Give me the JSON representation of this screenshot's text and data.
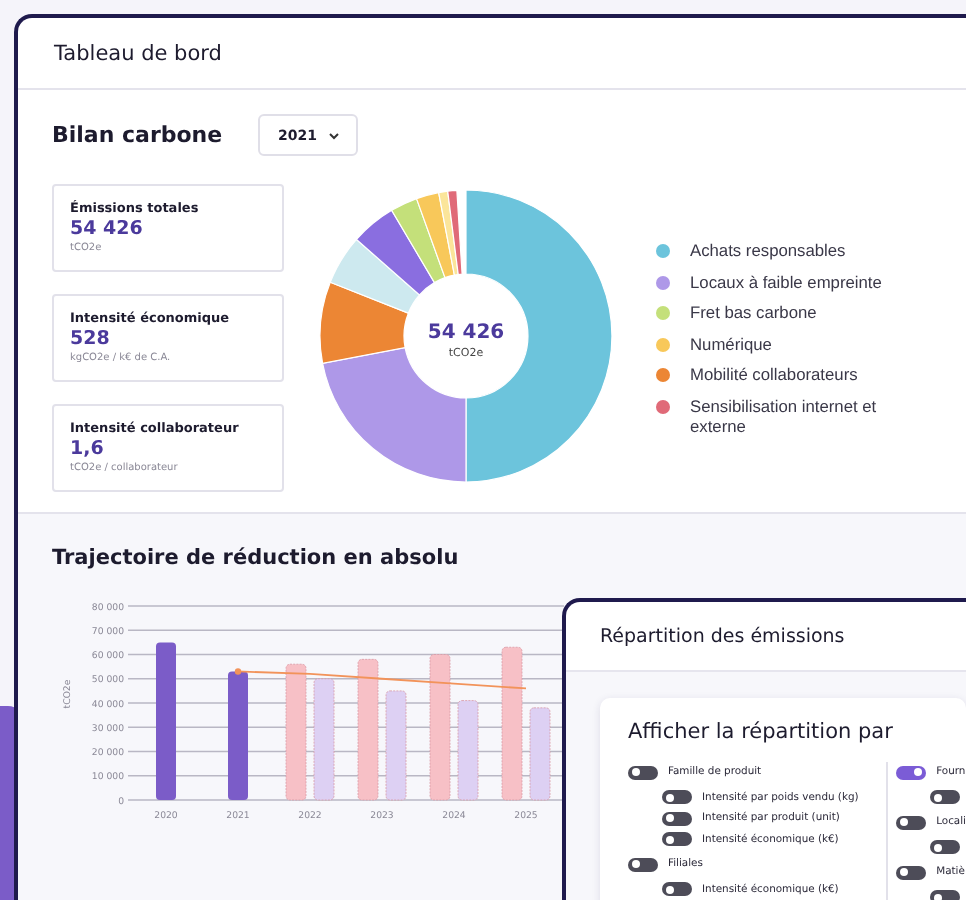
{
  "window": {
    "title": "Tableau de bord"
  },
  "bilan": {
    "title": "Bilan carbone",
    "year_select": {
      "value": "2021"
    },
    "kpis": [
      {
        "label": "Émissions totales",
        "value": "54 426",
        "unit": "tCO2e"
      },
      {
        "label": "Intensité économique",
        "value": "528",
        "unit": "kgCO2e / k€ de C.A."
      },
      {
        "label": "Intensité collaborateur",
        "value": "1,6",
        "unit": "tCO2e / collaborateur"
      }
    ],
    "donut": {
      "center_value": "54 426",
      "center_unit": "tCO2e"
    },
    "legend": [
      {
        "label": "Achats responsables",
        "color": "#6cc4dc"
      },
      {
        "label": "Locaux à faible empreinte",
        "color": "#ae98e8"
      },
      {
        "label": "Fret bas carbone",
        "color": "#c4e07a"
      },
      {
        "label": "Numérique",
        "color": "#f8c85a"
      },
      {
        "label": "Mobilité collaborateurs",
        "color": "#ec8634"
      },
      {
        "label": "Sensibilisation internet et externe",
        "color": "#e06a78"
      }
    ]
  },
  "trajectory": {
    "title": "Trajectoire de réduction en absolu",
    "chart_data": {
      "type": "bar",
      "ylabel": "tCO2e",
      "categories": [
        "2020",
        "2021",
        "2022",
        "2023",
        "2024",
        "2025"
      ],
      "series": [
        {
          "color": "#7b5cc8",
          "values": [
            65000,
            53000,
            null,
            null,
            null,
            null
          ]
        },
        {
          "color": "#f7c0c6",
          "values": [
            null,
            null,
            56000,
            58000,
            60000,
            63000
          ]
        },
        {
          "color": "#ddd0f3",
          "values": [
            null,
            null,
            50000,
            45000,
            41000,
            38000
          ]
        },
        {
          "color": "#f2935a",
          "type": "line",
          "values": [
            null,
            53000,
            52000,
            50000,
            48000,
            46000
          ]
        }
      ],
      "grid": true,
      "ylim": [
        0,
        80000
      ],
      "yticks": [
        {
          "value": 0,
          "label": "0"
        },
        {
          "value": 10000,
          "label": "10 000"
        },
        {
          "value": 20000,
          "label": "20 000"
        },
        {
          "value": 30000,
          "label": "30 000"
        },
        {
          "value": 40000,
          "label": "40 000"
        },
        {
          "value": 50000,
          "label": "50 000"
        },
        {
          "value": 60000,
          "label": "60 000"
        },
        {
          "value": 70000,
          "label": "70 000"
        },
        {
          "value": 80000,
          "label": "80 000"
        }
      ]
    }
  },
  "breakdown_panel": {
    "title": "Répartition des émissions",
    "heading": "Afficher la répartition par",
    "columns": [
      [
        {
          "label": "Famille de produit",
          "on": false,
          "children": [
            {
              "label": "Intensité par poids vendu (kg)",
              "on": false
            },
            {
              "label": "Intensité par produit (unit)",
              "on": false
            },
            {
              "label": "Intensité économique (k€)",
              "on": false
            }
          ]
        },
        {
          "label": "Filiales",
          "on": false,
          "children": [
            {
              "label": "Intensité économique (k€)",
              "on": false
            }
          ]
        }
      ],
      [
        {
          "label": "Fourn",
          "on": true,
          "children": [
            {
              "on": false
            }
          ]
        },
        {
          "label": "Locali",
          "on": false,
          "children": [
            {
              "on": false
            }
          ]
        },
        {
          "label": "Matiè",
          "on": false,
          "children": [
            {
              "on": false
            }
          ]
        }
      ]
    ]
  }
}
